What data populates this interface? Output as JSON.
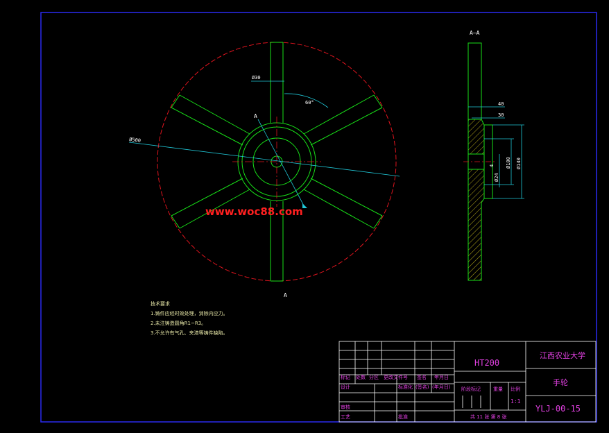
{
  "colors": {
    "background": "#000000",
    "frame": "#2a2af0",
    "outline_red": "#e0141e",
    "part_green": "#18e018",
    "dimension_cyan": "#20c8d8",
    "table_white": "#ffffff",
    "text_yellow": "#e8e8a8",
    "text_magenta": "#e040e0",
    "watermark_red": "#ff2020",
    "hatch_yellow": "#e8d820",
    "text_green": "#18e018"
  },
  "section": {
    "marker_top": "A",
    "marker_bottom": "A",
    "label": "A—A"
  },
  "dims": {
    "spoke_width": "Ø30",
    "angle": "60°",
    "outer_diameter": "Ø500",
    "side_40": "40",
    "side_30": "30",
    "side_dia_140": "Ø140",
    "side_dia_100": "Ø100",
    "side_dia_24": "Ø24",
    "side_small": "4"
  },
  "watermark": "www.woc88.com",
  "notes": {
    "title": "技术要求",
    "lines": [
      "1.铸件应经时效处理，消除内应力。",
      "2.未注铸造圆角R1~R3。",
      "3.不允许有气孔、夹渣等铸件缺陷。"
    ]
  },
  "title_block": {
    "material": "HT200",
    "school": "江西农业大学",
    "part_name": "手轮",
    "drawing_no": "YLJ-00-15",
    "headers_row": [
      "标记",
      "处数",
      "分区",
      "更改文件号",
      "签名",
      "年月日"
    ],
    "row_design": [
      "设计",
      "标准化",
      "(签名)",
      "(年月日)"
    ],
    "stage_label": "阶段标记",
    "weight_label": "重量",
    "scale_label": "比例",
    "scale_value": "1:1",
    "review": "审核",
    "process": "工艺",
    "approve": "批准",
    "sheet_info": "共 11 张  第 8 张"
  }
}
